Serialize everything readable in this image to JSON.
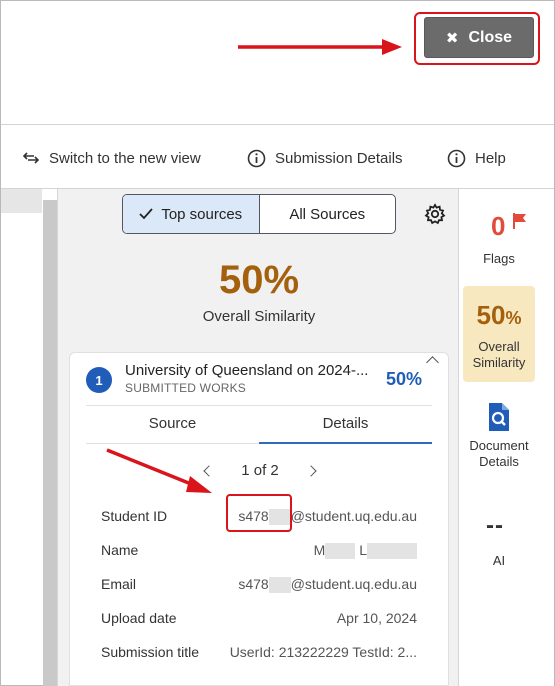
{
  "header": {
    "close_label": "Close",
    "close_icon": "x-icon"
  },
  "toolbar": {
    "switch_label": "Switch to the new view",
    "submission_details_label": "Submission Details",
    "help_label": "Help"
  },
  "panel": {
    "toggle": {
      "top_sources": "Top sources",
      "all_sources": "All Sources",
      "active": "Top sources"
    },
    "overall_pct": "50%",
    "overall_label": "Overall Similarity",
    "source": {
      "number": "1",
      "name": "University of Queensland on 2024-...",
      "type": "SUBMITTED WORKS",
      "pct": "50%"
    },
    "tabs": {
      "source": "Source",
      "details": "Details",
      "active": "Details"
    },
    "pager": "1 of 2",
    "details": {
      "student_id_label": "Student ID",
      "student_id_prefix": "s478",
      "student_id_suffix": "@student.uq.edu.au",
      "name_label": "Name",
      "name_first": "M",
      "name_last": "L",
      "email_label": "Email",
      "email_prefix": "s478",
      "email_suffix": "@student.uq.edu.au",
      "upload_label": "Upload date",
      "upload_value": "Apr 10, 2024",
      "title_label": "Submission title",
      "title_value": "UserId: 213222229 TestId: 2..."
    }
  },
  "rail": {
    "flags_count": "0",
    "flags_label": "Flags",
    "sim_pct": "50",
    "sim_pct_unit": "%",
    "sim_label_1": "Overall",
    "sim_label_2": "Similarity",
    "doc_label_1": "Document",
    "doc_label_2": "Details",
    "ai_value": "--",
    "ai_label": "AI"
  },
  "colors": {
    "accent_blue": "#1f5db8",
    "similarity_orange": "#a5600d",
    "flag_red": "#e24a3b",
    "callout_red": "#d9141a"
  }
}
